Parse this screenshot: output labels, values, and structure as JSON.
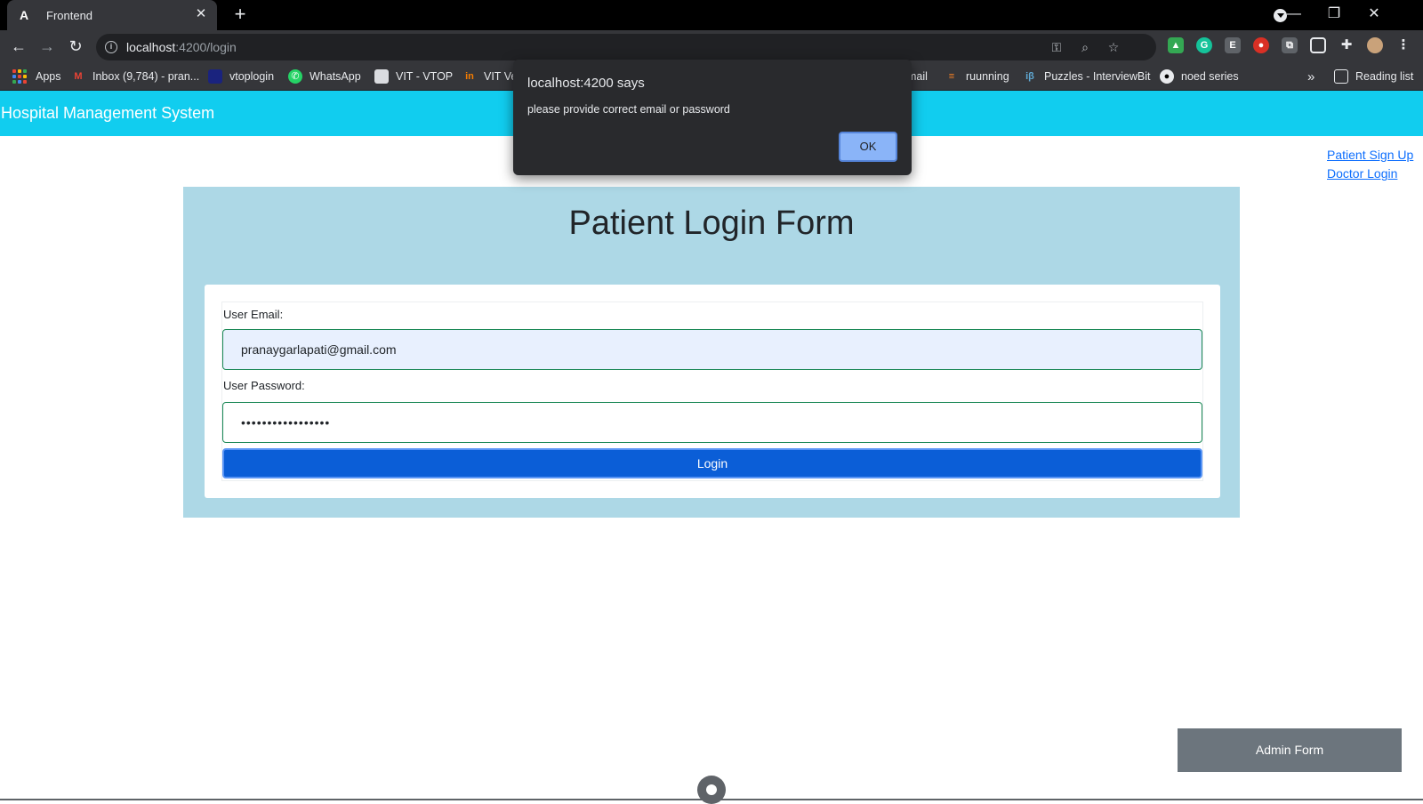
{
  "browser": {
    "tab_title": "Frontend",
    "tab_favicon": "angular-logo-icon",
    "address_host": "localhost",
    "address_path": ":4200/login",
    "bookmarks": [
      {
        "label": "Apps",
        "icon": "apps-grid-icon"
      },
      {
        "label": "Inbox (9,784) - pran...",
        "icon": "gmail-icon"
      },
      {
        "label": "vtoplogin",
        "icon": "vtop-icon"
      },
      {
        "label": "WhatsApp",
        "icon": "whatsapp-icon"
      },
      {
        "label": "VIT - VTOP",
        "icon": "vtop-page-icon"
      },
      {
        "label": "VIT Ve",
        "icon": "vit-icon"
      },
      {
        "label": "mail",
        "icon": "mail-icon"
      },
      {
        "label": "ruunning",
        "icon": "stackoverflow-icon"
      },
      {
        "label": "Puzzles - InterviewBit",
        "icon": "interviewbit-icon"
      },
      {
        "label": "noed series",
        "icon": "github-icon"
      }
    ],
    "overflow_label": "»",
    "reading_list": "Reading list"
  },
  "app": {
    "title": "Hospital Management System",
    "links": {
      "patient_signup": "Patient Sign Up",
      "doctor_login": "Doctor Login"
    }
  },
  "form": {
    "heading": "Patient Login Form",
    "email_label": "User Email:",
    "email_value": "pranaygarlapati@gmail.com",
    "password_label": "User Password:",
    "password_value": "•••••••••••••••••",
    "login_button": "Login"
  },
  "admin_button": "Admin Form",
  "alert": {
    "title": "localhost:4200 says",
    "message": "please provide correct email or password",
    "ok_button": "OK"
  },
  "colors": {
    "header": "#11cdef",
    "form_background": "#add8e6",
    "login_button": "#0b5ed7",
    "admin_button": "#6c757d",
    "alert_ok": "#8ab4f8"
  }
}
